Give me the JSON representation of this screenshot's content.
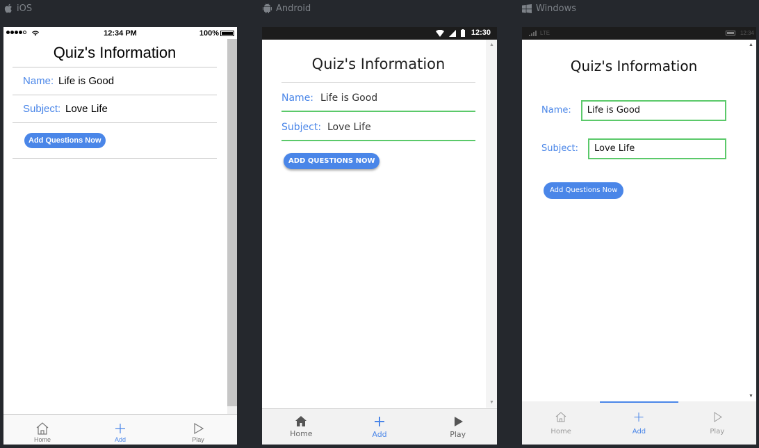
{
  "platforms": {
    "ios": {
      "label": "iOS"
    },
    "android": {
      "label": "Android"
    },
    "windows": {
      "label": "Windows"
    }
  },
  "ios_status": {
    "time": "12:34 PM",
    "battery": "100%"
  },
  "android_status": {
    "time": "12:30"
  },
  "windows_status": {
    "network": "LTE",
    "time": "12:34"
  },
  "page": {
    "title": "Quiz's Information",
    "name_label": "Name:",
    "name_value": "Life is Good",
    "subject_label": "Subject:",
    "subject_value": "Love Life",
    "add_button": "Add Questions Now",
    "add_button_android": "ADD QUESTIONS NOW"
  },
  "tabs": [
    {
      "label": "Home",
      "icon": "home-icon",
      "active": false
    },
    {
      "label": "Add",
      "icon": "plus-icon",
      "active": true
    },
    {
      "label": "Play",
      "icon": "play-icon",
      "active": false
    }
  ],
  "colors": {
    "accent": "#4a86e8",
    "field_underline": "#5bc96a",
    "background": "#25282d"
  }
}
